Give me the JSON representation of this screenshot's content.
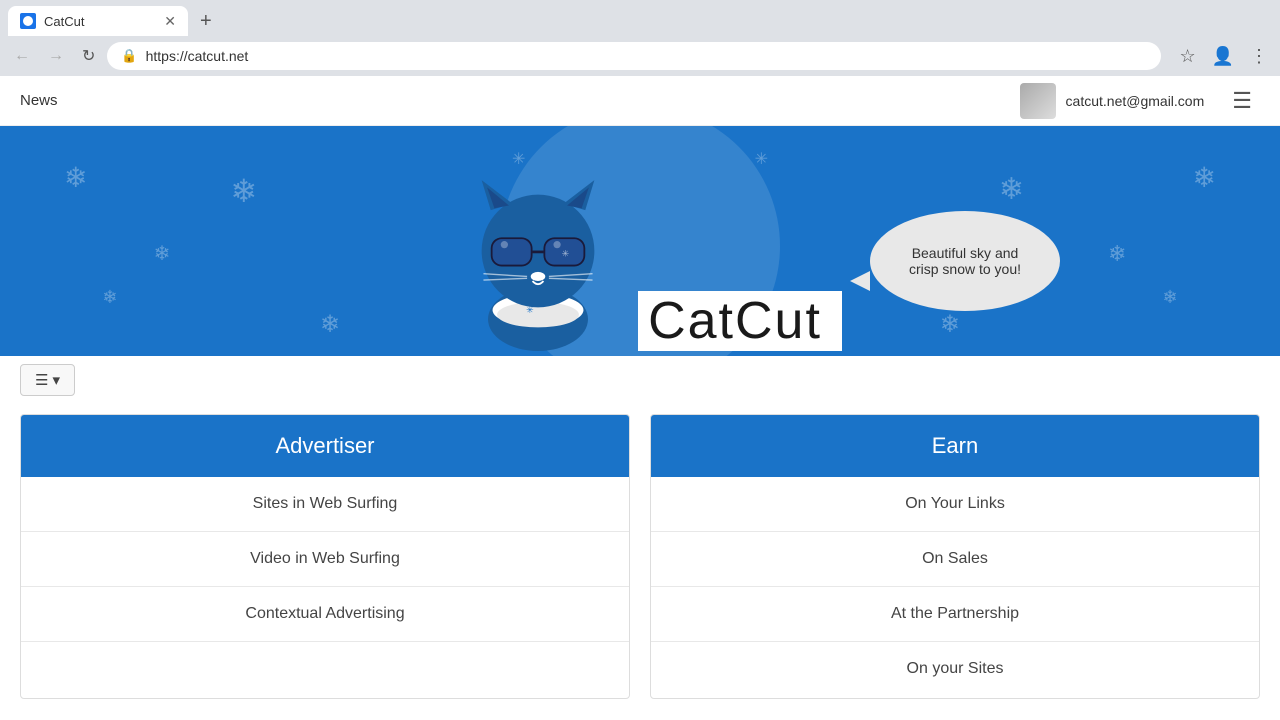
{
  "browser": {
    "tab_title": "CatCut",
    "url": "https://catcut.net",
    "new_tab_label": "+"
  },
  "nav": {
    "news_label": "News",
    "user_email": "catcut.net@gmail.com"
  },
  "hero": {
    "brand_name": "CatCut",
    "speech_bubble_line1": "Beautiful sky and",
    "speech_bubble_line2": "crisp snow to you!"
  },
  "menu_toggle_label": "☰ ▾",
  "advertiser_card": {
    "header": "Advertiser",
    "rows": [
      "Sites in Web Surfing",
      "Video in Web Surfing",
      "Contextual Advertising",
      ""
    ]
  },
  "earn_card": {
    "header": "Earn",
    "rows": [
      "On Your Links",
      "On Sales",
      "At the Partnership",
      "On your Sites"
    ]
  }
}
